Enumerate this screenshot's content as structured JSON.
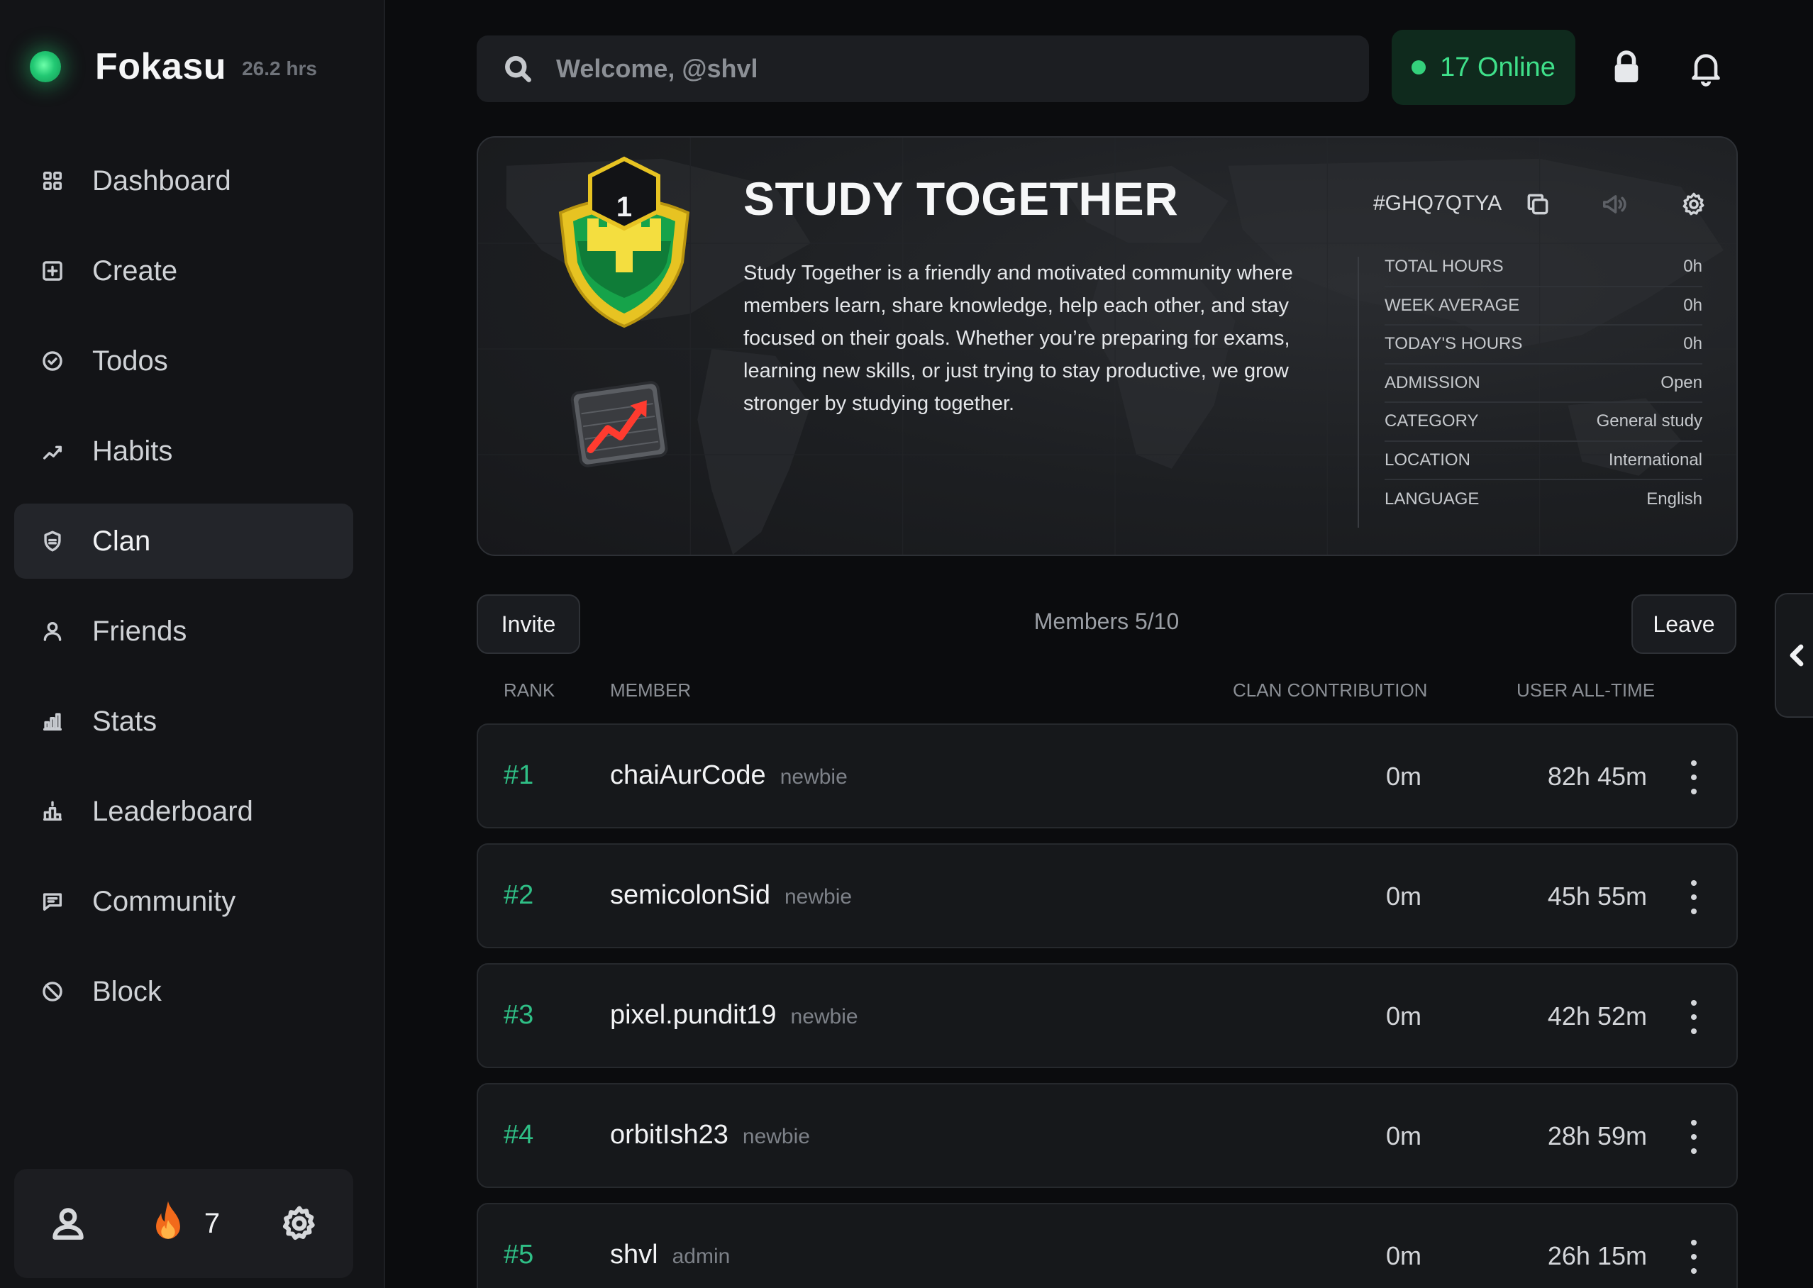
{
  "app": {
    "name": "Fokasu",
    "hours": "26.2 hrs"
  },
  "nav": {
    "items": [
      {
        "label": "Dashboard",
        "icon": "grid-icon"
      },
      {
        "label": "Create",
        "icon": "plus-square-icon"
      },
      {
        "label": "Todos",
        "icon": "check-circle-icon"
      },
      {
        "label": "Habits",
        "icon": "trend-icon"
      },
      {
        "label": "Clan",
        "icon": "shield-icon",
        "active": true
      },
      {
        "label": "Friends",
        "icon": "user-icon"
      },
      {
        "label": "Stats",
        "icon": "bar-chart-icon"
      },
      {
        "label": "Leaderboard",
        "icon": "podium-icon"
      },
      {
        "label": "Community",
        "icon": "chat-icon"
      },
      {
        "label": "Block",
        "icon": "ban-icon"
      }
    ]
  },
  "footer": {
    "streak": "7"
  },
  "header": {
    "search_placeholder": "Welcome, @shvl",
    "online_label": "17 Online",
    "colors": {
      "online": "#3fe08a",
      "online_bg": "#0f2a1d"
    }
  },
  "clan": {
    "level": "1",
    "name": "STUDY TOGETHER",
    "code": "#GHQ7QTYA",
    "description": "Study Together is a friendly and motivated community where members learn, share knowledge, help each other, and stay focused on their goals. Whether you’re preparing for exams, learning new skills, or just trying to stay productive, we grow stronger by studying together.",
    "stats": [
      {
        "label": "TOTAL HOURS",
        "value": "0h"
      },
      {
        "label": "WEEK AVERAGE",
        "value": "0h"
      },
      {
        "label": "TODAY'S HOURS",
        "value": "0h"
      },
      {
        "label": "ADMISSION",
        "value": "Open"
      },
      {
        "label": "CATEGORY",
        "value": "General study"
      },
      {
        "label": "LOCATION",
        "value": "International"
      },
      {
        "label": "LANGUAGE",
        "value": "English"
      }
    ]
  },
  "members": {
    "invite_label": "Invite",
    "leave_label": "Leave",
    "count_label": "Members 5/10",
    "columns": {
      "rank": "RANK",
      "member": "MEMBER",
      "contribution": "CLAN CONTRIBUTION",
      "alltime": "USER ALL-TIME"
    },
    "rows": [
      {
        "rank": "#1",
        "name": "chaiAurCode",
        "role": "newbie",
        "contribution": "0m",
        "alltime": "82h 45m"
      },
      {
        "rank": "#2",
        "name": "semicolonSid",
        "role": "newbie",
        "contribution": "0m",
        "alltime": "45h 55m"
      },
      {
        "rank": "#3",
        "name": "pixel.pundit19",
        "role": "newbie",
        "contribution": "0m",
        "alltime": "42h 52m"
      },
      {
        "rank": "#4",
        "name": "orbitIsh23",
        "role": "newbie",
        "contribution": "0m",
        "alltime": "28h 59m"
      },
      {
        "rank": "#5",
        "name": "shvl",
        "role": "admin",
        "contribution": "0m",
        "alltime": "26h 15m"
      }
    ]
  }
}
